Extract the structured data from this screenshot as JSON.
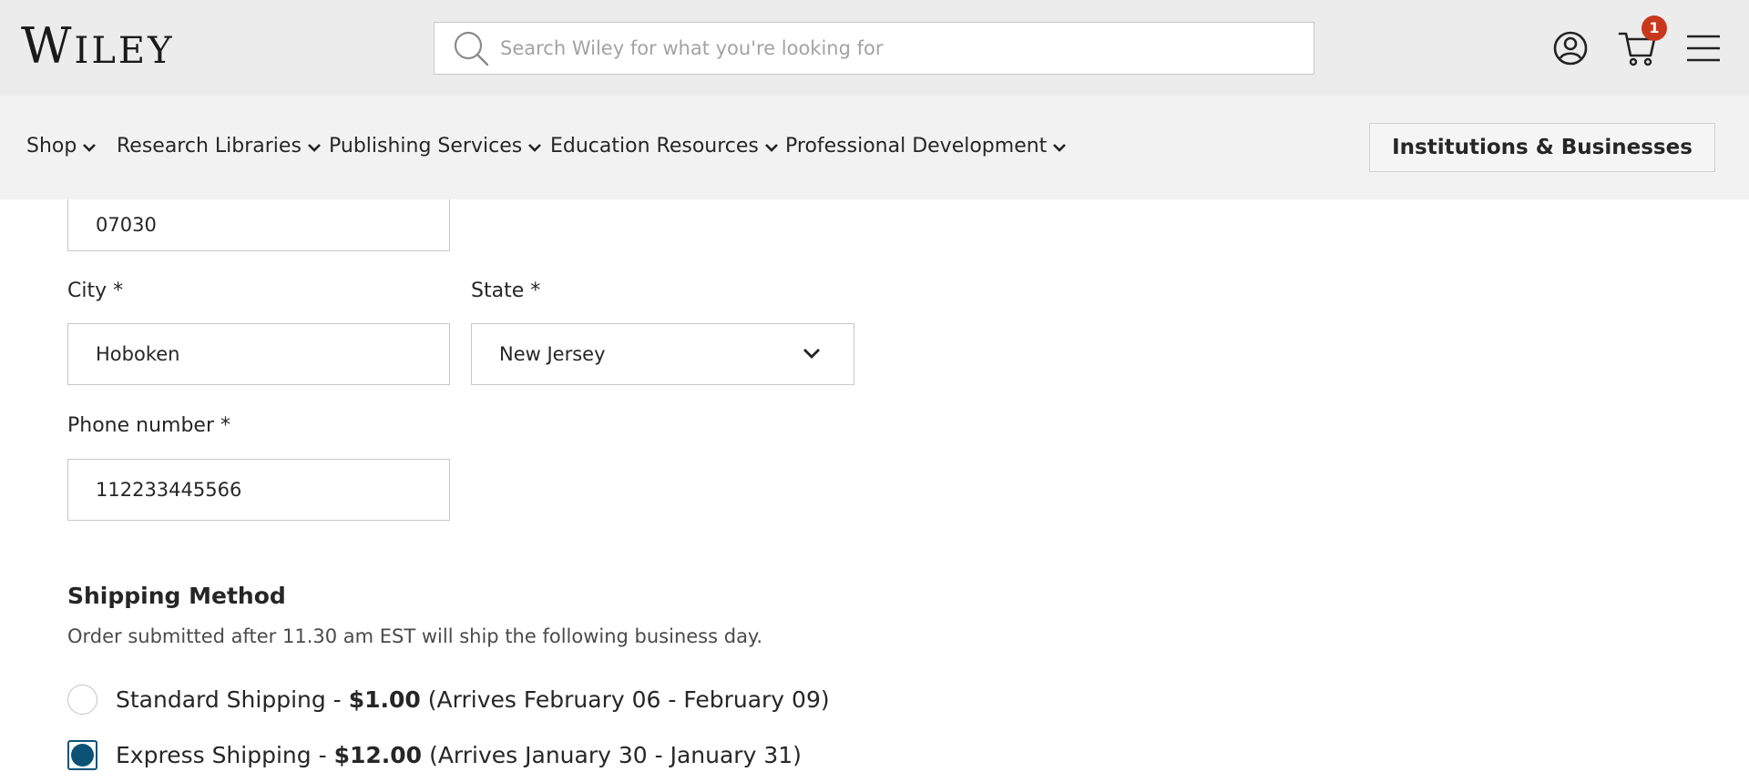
{
  "header": {
    "logo_first": "W",
    "logo_rest": "ILEY",
    "search_placeholder": "Search Wiley for what you're looking for",
    "cart_count": "1"
  },
  "nav": {
    "items": [
      {
        "label": "Shop"
      },
      {
        "label": "Research Libraries"
      },
      {
        "label": "Publishing Services"
      },
      {
        "label": "Education Resources"
      },
      {
        "label": "Professional Development"
      }
    ],
    "institutions_label": "Institutions & Businesses"
  },
  "form": {
    "zip_value": "07030",
    "city_label": "City *",
    "city_value": "Hoboken",
    "state_label": "State *",
    "state_value": "New Jersey",
    "phone_label": "Phone number *",
    "phone_value": "112233445566"
  },
  "shipping": {
    "title": "Shipping Method",
    "note": "Order submitted after 11.30 am EST will ship the following business day.",
    "options": [
      {
        "name": "Standard Shipping -",
        "price": "$1.00",
        "arrival": "(Arrives February 06 - February 09)",
        "selected": false
      },
      {
        "name": "Express Shipping -",
        "price": "$12.00",
        "arrival": "(Arrives January 30 - January 31)",
        "selected": true
      }
    ]
  },
  "colors": {
    "topbar_bg": "#ececec",
    "navbar_bg": "#f2f2f2",
    "badge": "#c8381e",
    "radio_selected": "#0b5275"
  }
}
